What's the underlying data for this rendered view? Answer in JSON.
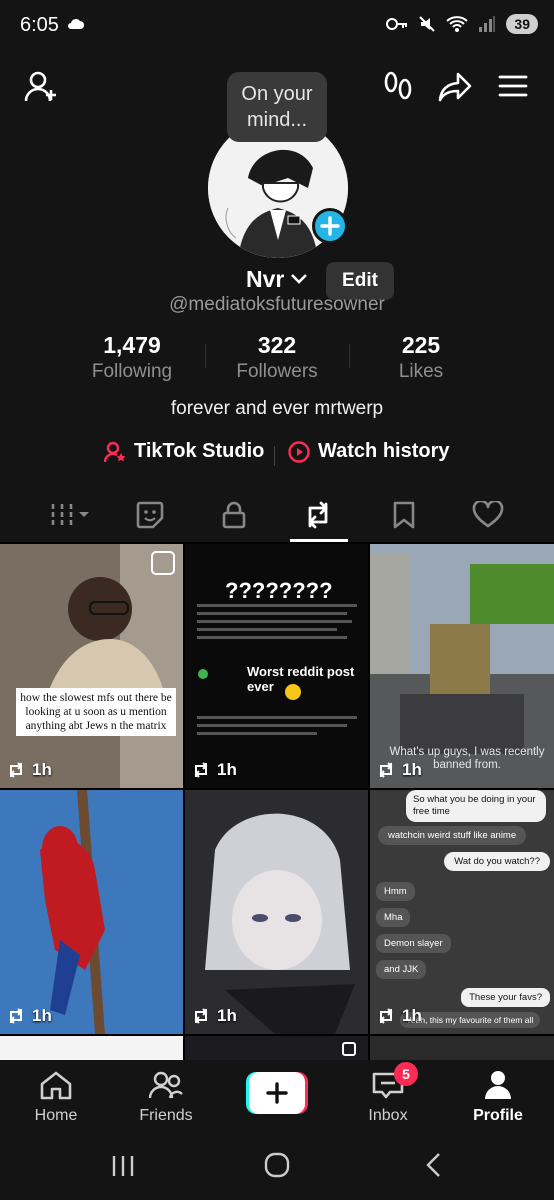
{
  "status_bar": {
    "time": "6:05",
    "battery": "39"
  },
  "profile": {
    "thought_bubble": "On your mind...",
    "display_name": "Nvr",
    "edit_label": "Edit",
    "username": "@mediatoksfuturesowner",
    "stats": [
      {
        "value": "1,479",
        "label": "Following"
      },
      {
        "value": "322",
        "label": "Followers"
      },
      {
        "value": "225",
        "label": "Likes"
      }
    ],
    "bio": "forever and ever mrtwerp",
    "links": {
      "studio": "TikTok Studio",
      "history": "Watch history"
    }
  },
  "tabs": [
    "videos-tab",
    "stickers-tab",
    "private-tab",
    "reposts-tab",
    "favorites-tab",
    "liked-tab"
  ],
  "grid": {
    "tiles": [
      {
        "time": "1h",
        "caption": "how the slowest mfs out there be looking at u soon as u mention anything abt Jews n the matrix"
      },
      {
        "time": "1h",
        "question": "????????",
        "headline": "Worst reddit post ever"
      },
      {
        "time": "1h",
        "caption": "What's up guys, I was recently banned from."
      },
      {
        "time": "1h"
      },
      {
        "time": "1h"
      },
      {
        "time": "1h",
        "chat": [
          "So what you be doing in your free time",
          "watchcin weird stuff like anime",
          "Wat do you watch??",
          "Hmm",
          "Mha",
          "Demon slayer",
          "and JJK",
          "These your favs?",
          "Yeah, this my favourite of them all"
        ]
      }
    ]
  },
  "bottom_nav": {
    "home": "Home",
    "friends": "Friends",
    "inbox": "Inbox",
    "inbox_badge": "5",
    "profile": "Profile"
  }
}
